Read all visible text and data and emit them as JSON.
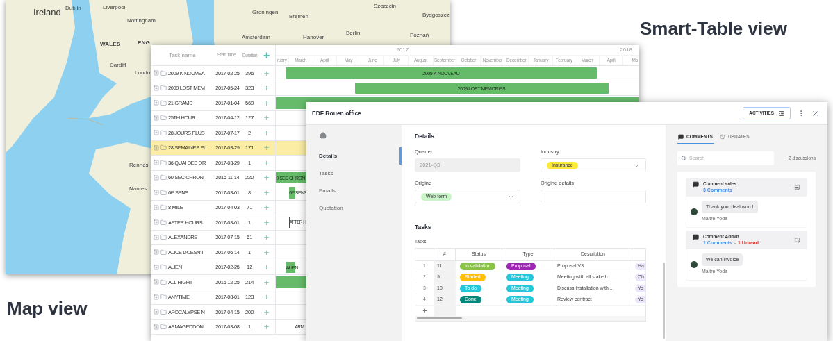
{
  "smart_table_caption": "Smart-Table view",
  "map_caption": "Map view",
  "map": {
    "labels": [
      {
        "text": "Ireland",
        "kind": "country"
      },
      {
        "text": "Dublin",
        "kind": "city"
      },
      {
        "text": "Liverpool",
        "kind": "city"
      },
      {
        "text": "Nottingham",
        "kind": "city"
      },
      {
        "text": "WALES",
        "kind": "region"
      },
      {
        "text": "ENG",
        "kind": "region"
      },
      {
        "text": "Cardiff",
        "kind": "city"
      },
      {
        "text": "Londo",
        "kind": "city"
      },
      {
        "text": "Groningen",
        "kind": "city"
      },
      {
        "text": "Bremen",
        "kind": "city"
      },
      {
        "text": "Amsterdam",
        "kind": "city"
      },
      {
        "text": "Hanover",
        "kind": "city"
      },
      {
        "text": "Berlin",
        "kind": "city"
      },
      {
        "text": "Szczecin",
        "kind": "city"
      },
      {
        "text": "Bydgoszcz",
        "kind": "city"
      },
      {
        "text": "Poznań",
        "kind": "city"
      },
      {
        "text": "Rennes",
        "kind": "city"
      },
      {
        "text": "Nantes",
        "kind": "city"
      }
    ]
  },
  "gantt": {
    "columns": [
      "Task name",
      "Start time",
      "Duration"
    ],
    "add_symbol": "+",
    "years": [
      "2017",
      "2018"
    ],
    "months": [
      "ruary",
      "March",
      "April",
      "May",
      "June",
      "July",
      "August",
      "September",
      "October",
      "November",
      "December",
      "January",
      "February",
      "March",
      "April",
      "Ma"
    ],
    "rows": [
      {
        "name": "2009 K NOUVEA",
        "start": "2017-02-25",
        "duration": "396",
        "selected": false,
        "bar_label": "2009 K NOUVEAU"
      },
      {
        "name": "2009 LOST MEM",
        "start": "2017-05-24",
        "duration": "323",
        "selected": false,
        "bar_label": "2009 LOST MEMORIES"
      },
      {
        "name": "21 GRAMS",
        "start": "2017-01-04",
        "duration": "569",
        "selected": false
      },
      {
        "name": "25TH HOUR",
        "start": "2017-04-12",
        "duration": "127",
        "selected": false
      },
      {
        "name": "28 JOURS PLUS",
        "start": "2017-07-17",
        "duration": "2",
        "selected": false
      },
      {
        "name": "28 SEMAINES PL",
        "start": "2017-03-29",
        "duration": "171",
        "selected": true
      },
      {
        "name": "36 QUAI DES OR",
        "start": "2017-03-29",
        "duration": "1",
        "selected": false
      },
      {
        "name": "60 SEC CHRON",
        "start": "2016-11-14",
        "duration": "220",
        "selected": false,
        "bar_label": "0 SEC CHRON"
      },
      {
        "name": "6E SENS",
        "start": "2017-03-01",
        "duration": "8",
        "selected": false,
        "bar_label": "6E SENS"
      },
      {
        "name": "8 MILE",
        "start": "2017-04-03",
        "duration": "71",
        "selected": false
      },
      {
        "name": "AFTER HOURS",
        "start": "2017-03-01",
        "duration": "1",
        "selected": false,
        "bar_label": "AFTER H"
      },
      {
        "name": "ALEXANDRE",
        "start": "2017-07-15",
        "duration": "61",
        "selected": false
      },
      {
        "name": "ALICE DOESN'T",
        "start": "2017-06-14",
        "duration": "1",
        "selected": false
      },
      {
        "name": "ALIEN",
        "start": "2017-02-25",
        "duration": "12",
        "selected": false,
        "bar_label": "ALIEN"
      },
      {
        "name": "ALL RIGHT",
        "start": "2016-12-25",
        "duration": "214",
        "selected": false
      },
      {
        "name": "ANYTIME",
        "start": "2017-08-01",
        "duration": "123",
        "selected": false
      },
      {
        "name": "APOCALYPSE N",
        "start": "2017-04-15",
        "duration": "200",
        "selected": false
      },
      {
        "name": "ARMAGEDDON",
        "start": "2017-03-08",
        "duration": "1",
        "selected": false,
        "bar_label": "ARM"
      }
    ]
  },
  "dialog": {
    "title": "EDF Rouen office",
    "activities_button": "ACTIVITIES",
    "nav": [
      {
        "label": "Details",
        "selected": true
      },
      {
        "label": "Tasks",
        "selected": false
      },
      {
        "label": "Emails",
        "selected": false
      },
      {
        "label": "Quotation",
        "selected": false
      }
    ],
    "details_heading": "Details",
    "fields": [
      {
        "label": "Quarter",
        "kind": "text",
        "value": "2021-Q3",
        "disabled": true
      },
      {
        "label": "Industry",
        "kind": "select",
        "value": "Insurance",
        "color": "#fde93a"
      },
      {
        "label": "Origine",
        "kind": "select",
        "value": "Web form",
        "color": "#c8f5c8"
      },
      {
        "label": "Origine details",
        "kind": "text",
        "disabled": false
      }
    ],
    "tasks_heading": "Tasks",
    "tasks_table_label": "Tasks",
    "table": {
      "columns": [
        "#",
        "Status",
        "Type",
        "Description"
      ],
      "rows": [
        {
          "index": "1",
          "number": "11",
          "status": {
            "label": "In validation",
            "color": "#8bc34a"
          },
          "type": {
            "label": "Proposal",
            "color": "#9c27b0"
          },
          "description": "Proposal V3",
          "column_6": "Ha"
        },
        {
          "index": "2",
          "number": "9",
          "status": {
            "label": "Started",
            "color": "#ffc107"
          },
          "type": {
            "label": "Meeting",
            "color": "#26c6da"
          },
          "description": "Meeting with all stake h...",
          "column_6": "Ch"
        },
        {
          "index": "3",
          "number": "10",
          "status": {
            "label": "To do",
            "color": "#26c6da"
          },
          "type": {
            "label": "Meeting",
            "color": "#26c6da"
          },
          "description": "Discuss installation with ...",
          "column_6": "Yo"
        },
        {
          "index": "4",
          "number": "12",
          "status": {
            "label": "Done",
            "color": "#00897b"
          },
          "type": {
            "label": "Meeting",
            "color": "#26c6da"
          },
          "description": "Review contract",
          "column_6": "Yo"
        }
      ],
      "add_symbol": "+"
    },
    "activity": {
      "tabs": [
        {
          "label": "COMMENTS",
          "kind": "comments",
          "selected": true
        },
        {
          "label": "UPDATES",
          "kind": "updates",
          "selected": false
        }
      ],
      "search_placeholder": "Search",
      "discussions_count": "2 discussions",
      "discussions": [
        {
          "title": "Comment sales",
          "comments": "3 Comments",
          "messages": [
            {
              "text": "Thank you, deal won !",
              "author": "Maitre Yoda"
            }
          ]
        },
        {
          "title": "Comment Admin",
          "comments": "1 Comments",
          "unread": "1 Unread",
          "messages": [
            {
              "text": "We can invoice",
              "author": "Maitre Yoda"
            }
          ]
        }
      ]
    }
  }
}
